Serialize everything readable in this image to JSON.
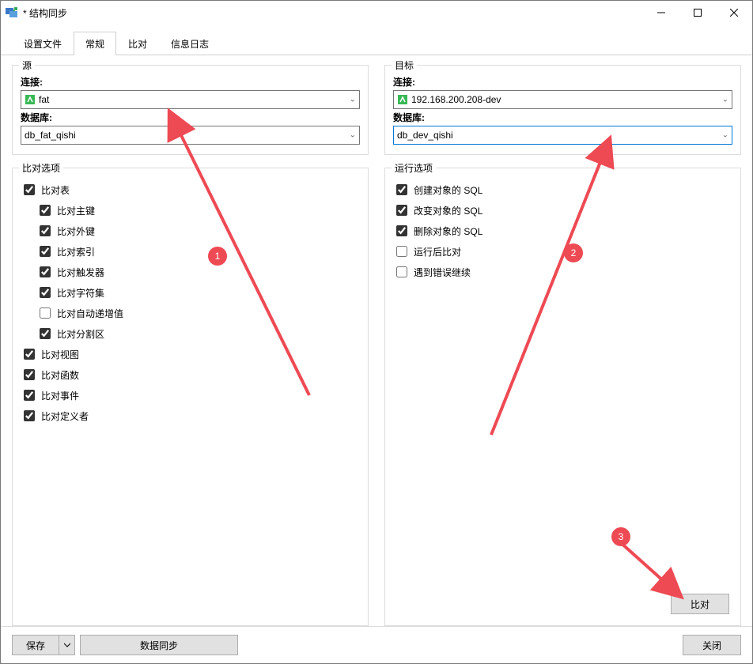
{
  "window": {
    "title": "* 结构同步"
  },
  "tabs": [
    {
      "label": "设置文件",
      "active": false
    },
    {
      "label": "常规",
      "active": true
    },
    {
      "label": "比对",
      "active": false
    },
    {
      "label": "信息日志",
      "active": false
    }
  ],
  "source": {
    "legend": "源",
    "connection_label": "连接:",
    "connection_value": "fat",
    "database_label": "数据库:",
    "database_value": "db_fat_qishi"
  },
  "target": {
    "legend": "目标",
    "connection_label": "连接:",
    "connection_value": "192.168.200.208-dev",
    "database_label": "数据库:",
    "database_value": "db_dev_qishi"
  },
  "compare_options": {
    "legend": "比对选项",
    "items": [
      {
        "label": "比对表",
        "checked": true,
        "indent": 0
      },
      {
        "label": "比对主键",
        "checked": true,
        "indent": 1
      },
      {
        "label": "比对外键",
        "checked": true,
        "indent": 1
      },
      {
        "label": "比对索引",
        "checked": true,
        "indent": 1
      },
      {
        "label": "比对触发器",
        "checked": true,
        "indent": 1
      },
      {
        "label": "比对字符集",
        "checked": true,
        "indent": 1
      },
      {
        "label": "比对自动递增值",
        "checked": false,
        "indent": 1
      },
      {
        "label": "比对分割区",
        "checked": true,
        "indent": 1
      },
      {
        "label": "比对视图",
        "checked": true,
        "indent": 0
      },
      {
        "label": "比对函数",
        "checked": true,
        "indent": 0
      },
      {
        "label": "比对事件",
        "checked": true,
        "indent": 0
      },
      {
        "label": "比对定义者",
        "checked": true,
        "indent": 0
      }
    ]
  },
  "run_options": {
    "legend": "运行选项",
    "items": [
      {
        "label": "创建对象的 SQL",
        "checked": true
      },
      {
        "label": "改变对象的 SQL",
        "checked": true
      },
      {
        "label": "删除对象的 SQL",
        "checked": true
      },
      {
        "label": "运行后比对",
        "checked": false
      },
      {
        "label": "遇到错误继续",
        "checked": false
      }
    ]
  },
  "buttons": {
    "compare": "比对",
    "save": "保存",
    "data_sync": "数据同步",
    "close": "关闭"
  },
  "annotations": {
    "b1": "1",
    "b2": "2",
    "b3": "3"
  }
}
